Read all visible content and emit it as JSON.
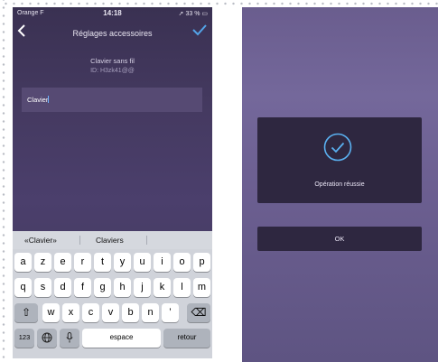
{
  "left_screen": {
    "status_bar": {
      "carrier": "Orange F",
      "time": "14:18",
      "battery": "33 %"
    },
    "nav": {
      "back_icon": "chevron-left-icon",
      "title": "Réglages accessoires",
      "confirm_icon": "checkmark-icon"
    },
    "device": {
      "name": "Clavier sans fil",
      "id": "ID: H3zk41@@"
    },
    "name_field": {
      "value": "Clavier"
    },
    "keyboard": {
      "suggestions": [
        "«Clavier»",
        "Claviers"
      ],
      "row1": [
        "a",
        "z",
        "e",
        "r",
        "t",
        "y",
        "u",
        "i",
        "o",
        "p"
      ],
      "row2": [
        "q",
        "s",
        "d",
        "f",
        "g",
        "h",
        "j",
        "k",
        "l",
        "m"
      ],
      "row3": [
        "w",
        "x",
        "c",
        "v",
        "b",
        "n",
        "’"
      ],
      "shift_icon": "⇧",
      "delete_icon": "⌫",
      "numbers_label": "123",
      "globe_icon": "globe-icon",
      "mic_icon": "microphone-icon",
      "space_label": "espace",
      "return_label": "retour"
    }
  },
  "right_screen": {
    "dialog": {
      "icon": "success-check-icon",
      "message": "Opération réussie"
    },
    "ok_label": "OK"
  },
  "colors": {
    "accent_check": "#53a4e8",
    "dialog_bg": "#2e2740",
    "success_circle": "#5ab0f0"
  }
}
